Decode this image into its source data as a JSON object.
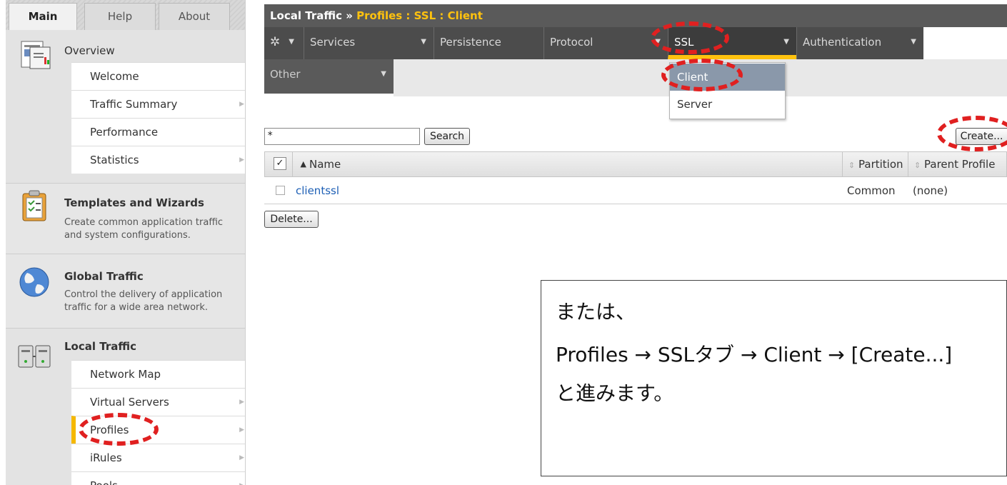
{
  "sidebar": {
    "tabs": [
      "Main",
      "Help",
      "About"
    ],
    "overview": {
      "title": "Overview",
      "items": [
        {
          "label": "Welcome",
          "arrow": ""
        },
        {
          "label": "Traffic Summary",
          "arrow": "▶"
        },
        {
          "label": "Performance",
          "arrow": ""
        },
        {
          "label": "Statistics",
          "arrow": "▶"
        }
      ]
    },
    "templates": {
      "title": "Templates and Wizards",
      "desc1": "Create common application traffic",
      "desc2": "and system configurations."
    },
    "global": {
      "title": "Global Traffic",
      "desc1": "Control the delivery of application",
      "desc2": "traffic for a wide area network."
    },
    "local": {
      "title": "Local Traffic",
      "items": [
        {
          "label": "Network Map",
          "arrow": ""
        },
        {
          "label": "Virtual Servers",
          "arrow": "▶"
        },
        {
          "label": "Profiles",
          "arrow": "▶"
        },
        {
          "label": "iRules",
          "arrow": "▶"
        },
        {
          "label": "Pools",
          "arrow": "▶"
        }
      ]
    }
  },
  "breadcrumb": {
    "section": "Local Traffic",
    "separator": "»",
    "path": "Profiles : SSL : Client"
  },
  "menu": {
    "gear": "✲",
    "services": "Services",
    "persistence": "Persistence",
    "protocol": "Protocol",
    "ssl": "SSL",
    "authentication": "Authentication",
    "other": "Other",
    "caret": "▼"
  },
  "ssl_dropdown": [
    "Client",
    "Server"
  ],
  "filter": {
    "value": "*",
    "search_label": "Search"
  },
  "create_label": "Create...",
  "table": {
    "headers": {
      "name": "Name",
      "partition": "Partition",
      "parent": "Parent Profile"
    },
    "rows": [
      {
        "name": "clientssl",
        "partition": "Common",
        "parent": "(none)"
      }
    ]
  },
  "delete_label": "Delete...",
  "note": {
    "line1": "または、",
    "line2": "Profiles → SSLタブ → Client → [Create...]",
    "line3": "と進みます。"
  },
  "colors": {
    "accent": "#ffc20e",
    "annotation": "#e02020",
    "link": "#1d5fb5"
  }
}
